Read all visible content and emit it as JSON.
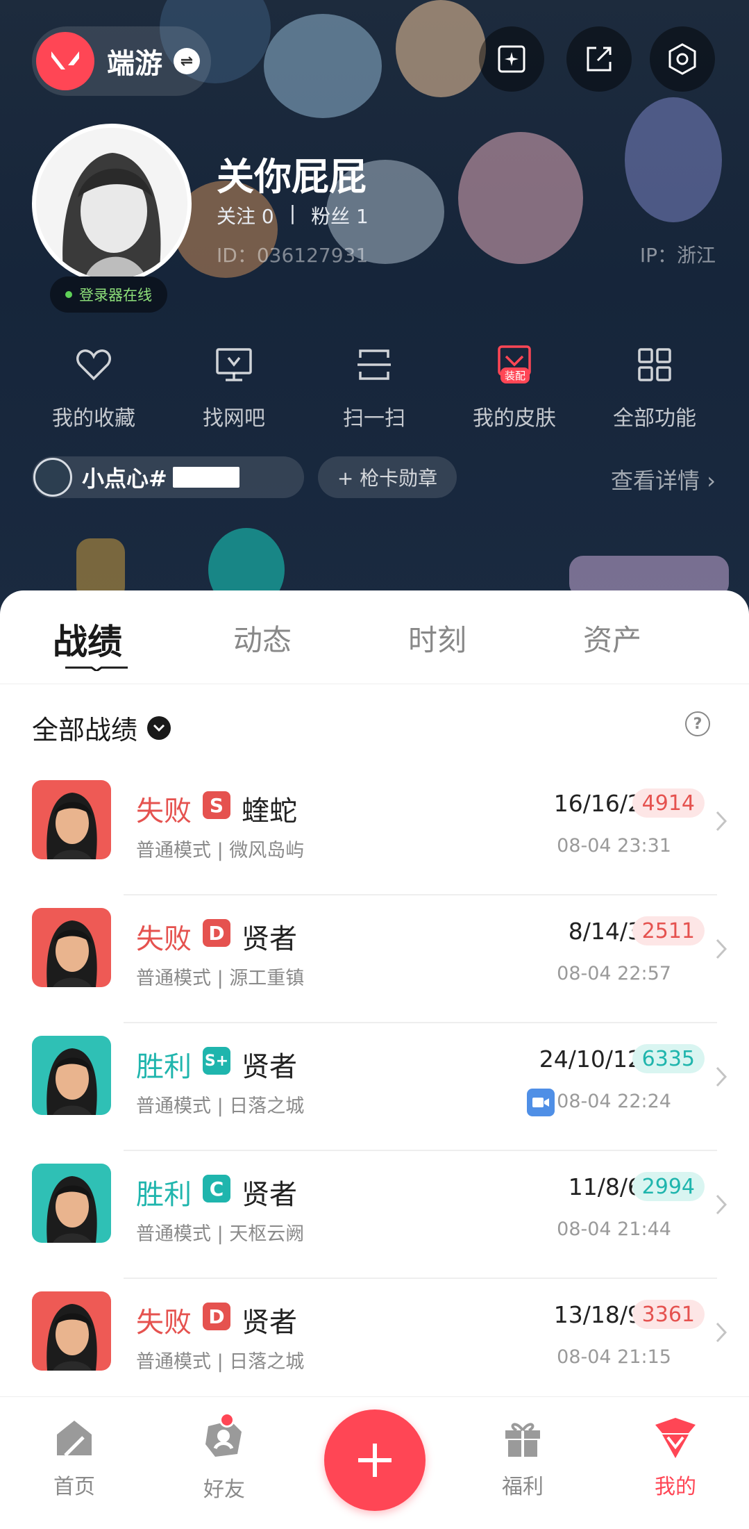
{
  "header": {
    "brand_name": "端游",
    "username": "关你屁屁",
    "follow": "关注 0",
    "stat_sep": "|",
    "fans": "粉丝 1",
    "user_id": "ID：036127931",
    "ip": "IP：浙江",
    "online": "登录器在线"
  },
  "quick": [
    {
      "label": "我的收藏",
      "icon": "heart-icon"
    },
    {
      "label": "找网吧",
      "icon": "monitor-icon"
    },
    {
      "label": "扫一扫",
      "icon": "scan-icon"
    },
    {
      "label": "我的皮肤",
      "icon": "skin-icon",
      "tag": "装配"
    },
    {
      "label": "全部功能",
      "icon": "grid-icon"
    }
  ],
  "card": {
    "name": "小点心#",
    "badge": "+ 枪卡勋章",
    "see_detail": "查看详情 ›"
  },
  "tabs": [
    "战绩",
    "动态",
    "时刻",
    "资产"
  ],
  "filter": {
    "label": "全部战绩",
    "help": "?"
  },
  "matches": [
    {
      "result": "失败",
      "grade": "S",
      "agent": "蝰蛇",
      "mode": "普通模式 | 微风岛屿",
      "kda": "16/16/2",
      "score": "4914",
      "time": "08-04 23:31",
      "win": false,
      "video": false
    },
    {
      "result": "失败",
      "grade": "D",
      "agent": "贤者",
      "mode": "普通模式 | 源工重镇",
      "kda": "8/14/3",
      "score": "2511",
      "time": "08-04 22:57",
      "win": false,
      "video": false
    },
    {
      "result": "胜利",
      "grade": "S+",
      "agent": "贤者",
      "mode": "普通模式 | 日落之城",
      "kda": "24/10/12",
      "score": "6335",
      "time": "08-04 22:24",
      "win": true,
      "video": true
    },
    {
      "result": "胜利",
      "grade": "C",
      "agent": "贤者",
      "mode": "普通模式 | 天枢云阙",
      "kda": "11/8/6",
      "score": "2994",
      "time": "08-04 21:44",
      "win": true,
      "video": false
    },
    {
      "result": "失败",
      "grade": "D",
      "agent": "贤者",
      "mode": "普通模式 | 日落之城",
      "kda": "13/18/9",
      "score": "3361",
      "time": "08-04 21:15",
      "win": false,
      "video": false
    }
  ],
  "nav": [
    {
      "label": "首页",
      "icon": "home-icon"
    },
    {
      "label": "好友",
      "icon": "friends-icon"
    },
    {
      "label": "福利",
      "icon": "gift-icon"
    },
    {
      "label": "我的",
      "icon": "profile-icon"
    }
  ],
  "colors": {
    "accent": "#ff4655",
    "win": "#1fb5ad",
    "lose": "#e5524f",
    "win_bg": "#d9f5f1",
    "lose_bg": "#fde6e6"
  }
}
